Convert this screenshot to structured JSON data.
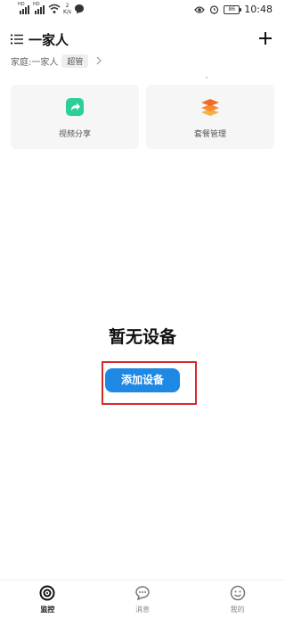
{
  "status_bar": {
    "net_speed_value": "2",
    "net_speed_unit": "K/s",
    "sim1": "HD",
    "sim2": "HD",
    "battery": "86",
    "time": "10:48"
  },
  "header": {
    "title": "一家人",
    "family_label": "家庭:一家人",
    "role_badge": "超管"
  },
  "features": [
    {
      "label": "视频分享",
      "icon": "share-icon",
      "color": "#2ccf9a"
    },
    {
      "label": "套餐管理",
      "icon": "layers-icon",
      "color": "#f58a2e"
    }
  ],
  "empty_state": {
    "title": "暂无设备",
    "add_button": "添加设备"
  },
  "bottom_nav": [
    {
      "label": "监控",
      "icon": "monitor-icon",
      "active": true
    },
    {
      "label": "消息",
      "icon": "message-icon",
      "active": false
    },
    {
      "label": "我的",
      "icon": "profile-icon",
      "active": false
    }
  ],
  "colors": {
    "primary": "#1e88e5",
    "highlight": "#d62b2b"
  }
}
